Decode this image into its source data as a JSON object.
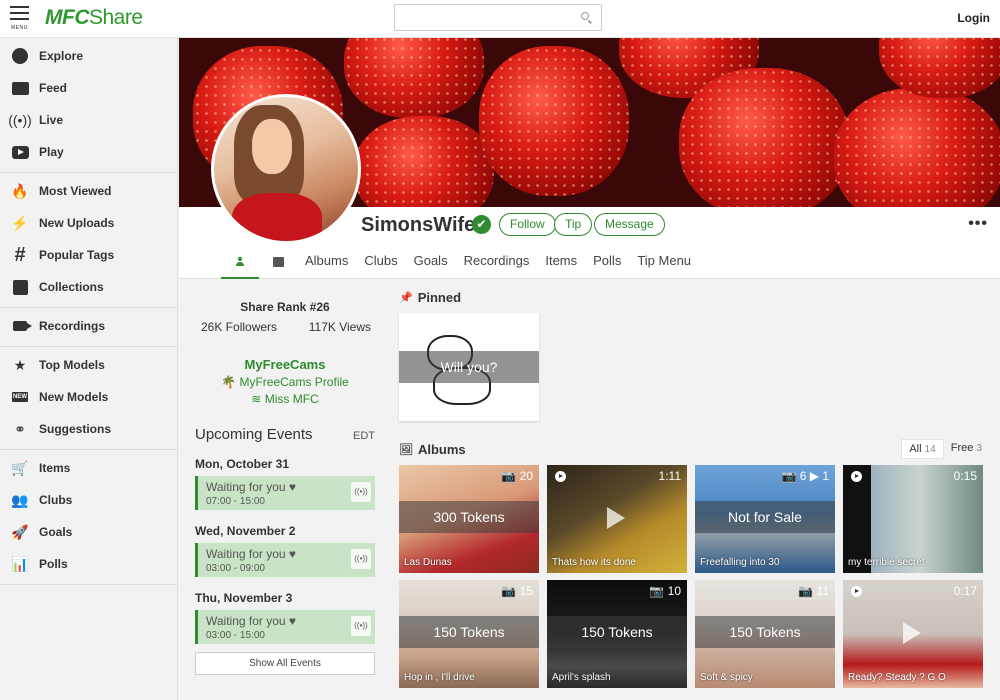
{
  "header": {
    "menu_label": "MENU",
    "logo_mfc": "MFC",
    "logo_share": "Share",
    "search_placeholder": "",
    "login_label": "Login"
  },
  "sidebar": {
    "groups": [
      [
        {
          "label": "Explore",
          "icon": "compass-icon"
        },
        {
          "label": "Feed",
          "icon": "feed-icon"
        },
        {
          "label": "Live",
          "icon": "live-broadcast-icon"
        },
        {
          "label": "Play",
          "icon": "play-icon"
        }
      ],
      [
        {
          "label": "Most Viewed",
          "icon": "flame-icon"
        },
        {
          "label": "New Uploads",
          "icon": "lightning-icon"
        },
        {
          "label": "Popular Tags",
          "icon": "hashtag-icon"
        },
        {
          "label": "Collections",
          "icon": "collections-icon"
        }
      ],
      [
        {
          "label": "Recordings",
          "icon": "video-camera-icon"
        }
      ],
      [
        {
          "label": "Top Models",
          "icon": "star-person-icon"
        },
        {
          "label": "New Models",
          "icon": "new-badge-icon"
        },
        {
          "label": "Suggestions",
          "icon": "rings-icon"
        }
      ],
      [
        {
          "label": "Items",
          "icon": "cart-icon"
        },
        {
          "label": "Clubs",
          "icon": "group-icon"
        },
        {
          "label": "Goals",
          "icon": "rocket-icon"
        },
        {
          "label": "Polls",
          "icon": "bar-chart-icon"
        }
      ]
    ]
  },
  "profile": {
    "username": "SimonsWife",
    "verified_glyph": "✔",
    "follow_label": "Follow",
    "tip_label": "Tip",
    "message_label": "Message",
    "more_label": "•••",
    "tabs": [
      "Albums",
      "Clubs",
      "Goals",
      "Recordings",
      "Items",
      "Polls",
      "Tip Menu"
    ]
  },
  "stats": {
    "rank": "Share Rank #26",
    "followers": "26K Followers",
    "views": "117K Views"
  },
  "mfc": {
    "title": "MyFreeCams",
    "profile_link": "MyFreeCams Profile",
    "miss_link": "Miss MFC"
  },
  "events": {
    "title": "Upcoming Events",
    "edt": "EDT",
    "live_glyph": "((•))",
    "items": [
      {
        "date": "Mon, October 31",
        "name": "Waiting for you ♥",
        "time": "07:00 - 15:00"
      },
      {
        "date": "Wed, November 2",
        "name": "Waiting for you ♥",
        "time": "03:00 - 09:00"
      },
      {
        "date": "Thu, November 3",
        "name": "Waiting for you ♥",
        "time": "03:00 - 15:00"
      }
    ],
    "show_all": "Show All Events"
  },
  "pinned": {
    "title": "Pinned",
    "overlay": "Will you?"
  },
  "albums": {
    "title": "Albums",
    "filter_all": "All",
    "filter_all_count": "14",
    "filter_free": "Free",
    "filter_free_count": "3",
    "tiles": [
      {
        "info": "📷 20",
        "price": "300 Tokens",
        "caption": "Las Dunas"
      },
      {
        "info": "1:11",
        "price": "",
        "caption": "Thats how its done"
      },
      {
        "info": "📷 6  ▶ 1",
        "price": "Not for Sale",
        "caption": "Freefalling into 30"
      },
      {
        "info": "0:15",
        "price": "",
        "caption": "my terrible secret"
      },
      {
        "info": "📷 15",
        "price": "150 Tokens",
        "caption": "Hop in , I'll drive"
      },
      {
        "info": "📷 10",
        "price": "150 Tokens",
        "caption": "April's splash"
      },
      {
        "info": "📷 11",
        "price": "150 Tokens",
        "caption": "Soft & spicy"
      },
      {
        "info": "0:17",
        "price": "",
        "caption": "Ready? Steady ? G O"
      }
    ]
  },
  "colors": {
    "accent": "#2e8b2e",
    "event_bg": "#c9e3c6"
  }
}
